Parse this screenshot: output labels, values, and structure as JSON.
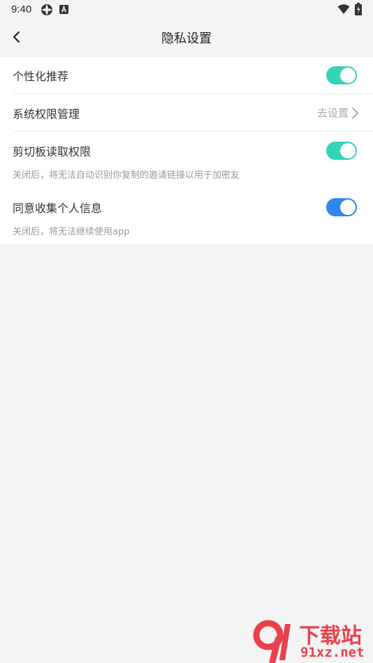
{
  "status_bar": {
    "time": "9:40",
    "icons": [
      "settings-icon",
      "a-icon",
      "wifi-icon",
      "battery-icon"
    ]
  },
  "header": {
    "title": "隐私设置",
    "back_icon": "chevron-left-icon"
  },
  "settings": {
    "personalized": {
      "label": "个性化推荐",
      "toggle_on": true,
      "toggle_color": "#33d3b8"
    },
    "permissions": {
      "label": "系统权限管理",
      "action": "去设置",
      "action_icon": "chevron-right-icon"
    },
    "clipboard": {
      "label": "剪切板读取权限",
      "toggle_on": true,
      "toggle_color": "#33d3b8",
      "description": "关闭后，将无法自动识别你复制的邀请链接以用于加密友"
    },
    "collect_info": {
      "label": "同意收集个人信息",
      "toggle_on": true,
      "toggle_color": "#2f86ee",
      "description": "关闭后，将无法继续使用app"
    }
  },
  "watermark": {
    "top": "下载站",
    "bottom": "91xz.net",
    "color": "#e8414b"
  }
}
